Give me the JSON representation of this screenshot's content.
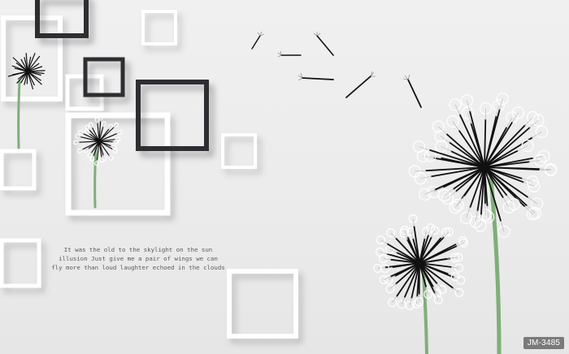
{
  "quote": {
    "line1": "It was the old to the skylight on the sun",
    "line2": "illusion Just give me a pair of wings we can",
    "line3": "fly more than loud laughter echoed in the clouds"
  },
  "watermark": "JM-3485",
  "colors": {
    "background": "#ececec",
    "frame_dark": "#2f2f33",
    "frame_white": "#ffffff",
    "stem": "#7fae7a",
    "seed_black": "#111111"
  }
}
